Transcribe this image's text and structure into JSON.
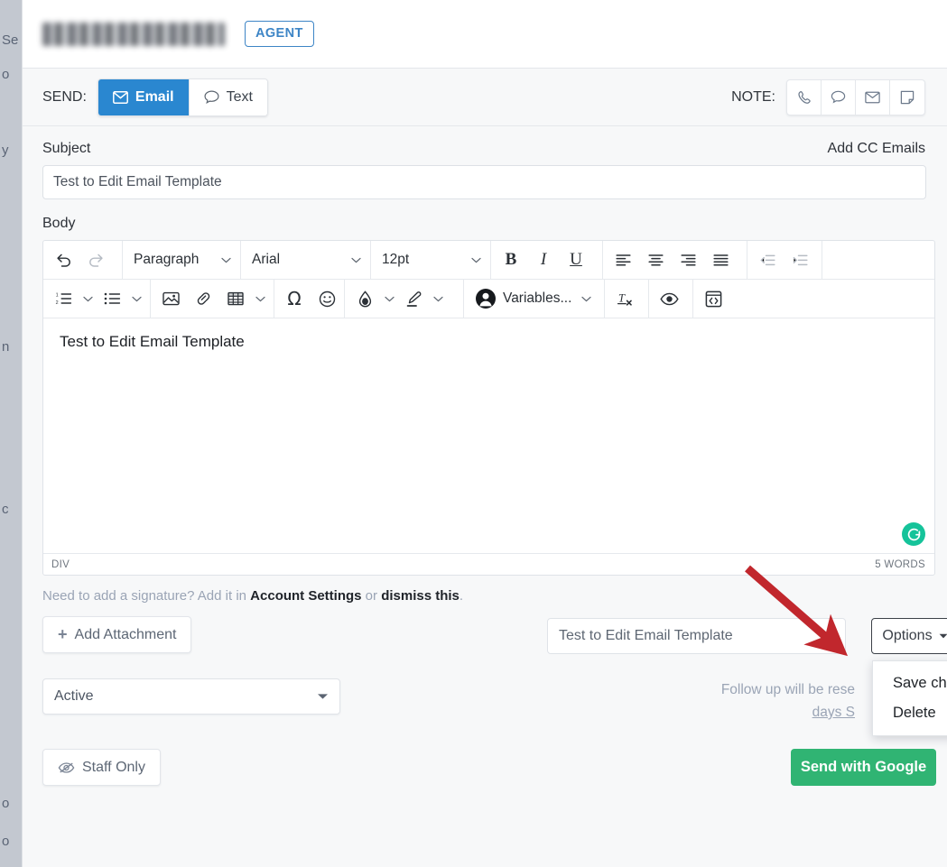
{
  "header": {
    "contact_name_redacted": "",
    "agent_badge": "AGENT"
  },
  "send_bar": {
    "send_label": "SEND:",
    "tabs": [
      {
        "label": "Email",
        "icon": "envelope-icon",
        "active": true
      },
      {
        "label": "Text",
        "icon": "chat-bubble-icon",
        "active": false
      }
    ],
    "note_label": "NOTE:",
    "note_icons": [
      "phone-icon",
      "chat-bubble-icon",
      "envelope-icon",
      "sticky-note-icon"
    ]
  },
  "compose": {
    "subject_label": "Subject",
    "cc_link": "Add CC Emails",
    "subject_value": "Test to Edit Email Template",
    "subject_placeholder": "Subject",
    "body_label": "Body"
  },
  "editor": {
    "toolbar_row1": {
      "undo_icon": "undo-icon",
      "redo_icon": "redo-icon",
      "block_format": "Paragraph",
      "font_family": "Arial",
      "font_size": "12pt",
      "bold": "B",
      "italic": "I",
      "underline": "U",
      "align_left_icon": "align-left-icon",
      "align_center_icon": "align-center-icon",
      "align_right_icon": "align-right-icon",
      "align_justify_icon": "align-justify-icon",
      "outdent_icon": "outdent-icon",
      "indent_icon": "indent-icon"
    },
    "toolbar_row2": {
      "numbered_list_icon": "numbered-list-icon",
      "bullet_list_icon": "bullet-list-icon",
      "image_icon": "image-icon",
      "link_icon": "link-icon",
      "table_icon": "table-icon",
      "special_char_icon": "omega-icon",
      "emoji_icon": "emoji-icon",
      "text_color_icon": "droplet-icon",
      "highlight_icon": "highlighter-pen-icon",
      "variables_label": "Variables...",
      "variables_icon": "person-icon",
      "clear_format_icon": "clear-formatting-icon",
      "preview_icon": "eye-icon",
      "source_code_icon": "source-code-icon"
    },
    "body_text": "Test to Edit Email Template",
    "grammarly_icon": "grammarly-icon",
    "status_left": "DIV",
    "status_right": "5 WORDS"
  },
  "signature_note": {
    "prefix": "Need to add a signature? Add it in ",
    "link1": "Account Settings",
    "middle": " or ",
    "link2": "dismiss this",
    "suffix": "."
  },
  "lower": {
    "add_attachment": "Add Attachment",
    "add_attachment_icon": "plus-icon",
    "template_value": "Test to Edit Email Template",
    "template_caret_icon": "chevron-down-icon",
    "options_label": "Options",
    "options_caret_icon": "caret-down-icon",
    "options_menu": [
      "Save changes",
      "Delete"
    ]
  },
  "status_row": {
    "status_value": "Active",
    "status_caret_icon": "chevron-down-icon",
    "followup_line1": "Follow up will be rese",
    "followup_line2": "days S"
  },
  "footer": {
    "staff_only": "Staff Only",
    "staff_only_icon": "eye-slash-icon",
    "send_button": "Send with Google"
  },
  "backdrop": {
    "fragments": [
      "Se",
      "o",
      "y",
      "n",
      "c",
      "o",
      "o"
    ]
  },
  "colors": {
    "primary_blue": "#2a87d0",
    "agent_badge": "#3d85c6",
    "send_green": "#30b473",
    "arrow_red": "#c1272d",
    "grammarly_green": "#15c39a",
    "muted_text": "#9aa4b5"
  }
}
